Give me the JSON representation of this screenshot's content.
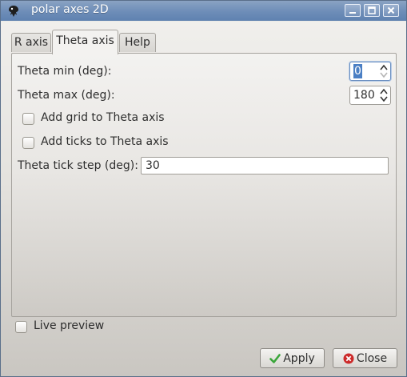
{
  "window": {
    "title": "polar axes 2D",
    "title_bar_color": "#6d8db8"
  },
  "tabs": [
    {
      "label": "R axis",
      "active": false
    },
    {
      "label": "Theta axis",
      "active": true
    },
    {
      "label": "Help",
      "active": false
    }
  ],
  "theta_tab": {
    "theta_min": {
      "label": "Theta min (deg):",
      "value": "0"
    },
    "theta_max": {
      "label": "Theta max (deg):",
      "value": "180"
    },
    "add_grid": {
      "label": "Add grid to Theta axis",
      "checked": false
    },
    "add_ticks": {
      "label": "Add ticks to Theta axis",
      "checked": false
    },
    "tick_step": {
      "label": "Theta tick step (deg):",
      "value": "30"
    }
  },
  "live_preview": {
    "label": "Live preview",
    "checked": false
  },
  "buttons": {
    "apply": {
      "label": "Apply",
      "icon": "check-icon",
      "icon_color": "#3aa63a"
    },
    "close": {
      "label": "Close",
      "icon": "close-circle-icon",
      "icon_color": "#cc2a2a"
    }
  }
}
